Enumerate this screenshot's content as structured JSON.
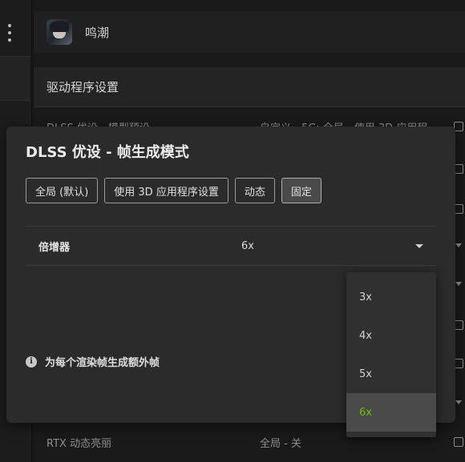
{
  "game": {
    "name": "鸣潮"
  },
  "section": {
    "title": "驱动程序设置"
  },
  "background_rows": [
    {
      "label": "DLSS 优设 - 模型预设",
      "value": "自定义 - 5G: 全局 - 使用 3D 应用程"
    },
    {
      "label": "RTX 动态亮丽",
      "value": "全局 - 关"
    }
  ],
  "modal": {
    "title": "DLSS 优设 - 帧生成模式",
    "chips": [
      "全局 (默认)",
      "使用 3D 应用程序设置",
      "动态",
      "固定"
    ],
    "active_chip": "固定",
    "setting": {
      "label": "倍增器",
      "value": "6x"
    },
    "info": "为每个渲染帧生成额外帧"
  },
  "dropdown": {
    "options": [
      "3x",
      "4x",
      "5x",
      "6x"
    ],
    "selected": "6x"
  },
  "colors": {
    "accent": "#76b900",
    "modal_bg": "#2b2b2b",
    "page_bg": "#161616"
  }
}
